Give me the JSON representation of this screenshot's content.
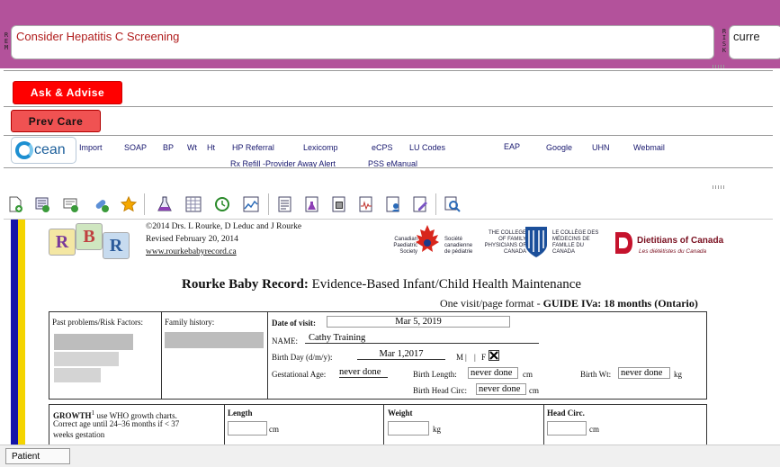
{
  "reminder": {
    "label": "REM",
    "text": "Consider Hepatitis C Screening"
  },
  "risk": {
    "label": "RISK",
    "text": "curre"
  },
  "buttons": {
    "ask_advise": "Ask & Advise",
    "prev_care": "Prev Care"
  },
  "ocean": {
    "logo_text": "cean"
  },
  "links_row1": [
    "Import",
    "SOAP",
    "BP",
    "Wt",
    "Ht",
    "HP Referral",
    "Lexicomp",
    "eCPS",
    "LU Codes",
    "EAP",
    "Google",
    "UHN",
    "Webmail"
  ],
  "links_row2": [
    "Rx Refill -Provider Away Alert",
    "PSS eManual"
  ],
  "toolbar_icons": [
    "new-document-icon",
    "add-template-icon",
    "add-note-icon",
    "pills-icon",
    "star-icon",
    "flask-icon",
    "calculator-table-icon",
    "history-icon",
    "chart-icon",
    "document-list-icon",
    "lab-document-icon",
    "form-document-icon",
    "ecg-document-icon",
    "person-document-icon",
    "edit-document-icon",
    "search-note-icon"
  ],
  "document": {
    "rbr_blocks": [
      "R",
      "B",
      "R"
    ],
    "credit_line1": "©2014 Drs. L Rourke, D Leduc and J Rourke",
    "credit_line2": "Revised February 20, 2014",
    "credit_line3": "www.rourkebabyrecord.ca",
    "cps_name_en": "Canadian Paediatric Society",
    "cps_name_fr": "Société canadienne de pédiatrie",
    "cfpc_name_en": "THE COLLEGE OF FAMILY PHYSICIANS OF CANADA",
    "cfpc_name_fr": "LE COLLÈGE DES MÉDECINS DE FAMILLE DU CANADA",
    "dietitians_en": "Dietitians of Canada",
    "dietitians_fr": "Les diététistes du Canada",
    "title_bold": "Rourke Baby Record:",
    "title_rest": " Evidence-Based Infant/Child Health Maintenance",
    "subtitle_pre": "One visit/page format - ",
    "subtitle_bold": "GUIDE IVa: 18 months (Ontario)",
    "past_problems_label": "Past problems/Risk Factors:",
    "family_history_label": "Family history:",
    "date_of_visit_label": "Date of visit:",
    "date_of_visit": "Mar 5, 2019",
    "name_label": "NAME:",
    "name": "Cathy Training",
    "birthday_label": "Birth Day (d/m/y):",
    "birthday": "Mar 1,2017",
    "sex_m": "M",
    "sex_f": "F",
    "gest_age_label": "Gestational Age:",
    "gest_age": "never done",
    "birth_length_label": "Birth Length:",
    "birth_length": "never done",
    "birth_length_unit": "cm",
    "birth_wt_label": "Birth Wt:",
    "birth_wt": "never done",
    "birth_wt_unit": "kg",
    "birth_head_label": "Birth Head Circ:",
    "birth_head": "never done",
    "birth_head_unit": "cm",
    "growth_text1": "GROWTH",
    "growth_text2": " use WHO growth charts.",
    "growth_text3": "Correct age until 24–36 months if < 37",
    "growth_text4": "weeks gestation",
    "length_label": "Length",
    "length_unit": "cm",
    "weight_label": "Weight",
    "weight_unit": "kg",
    "head_label": "Head Circ.",
    "head_unit": "cm"
  },
  "status": {
    "patient_tab": "Patient"
  }
}
